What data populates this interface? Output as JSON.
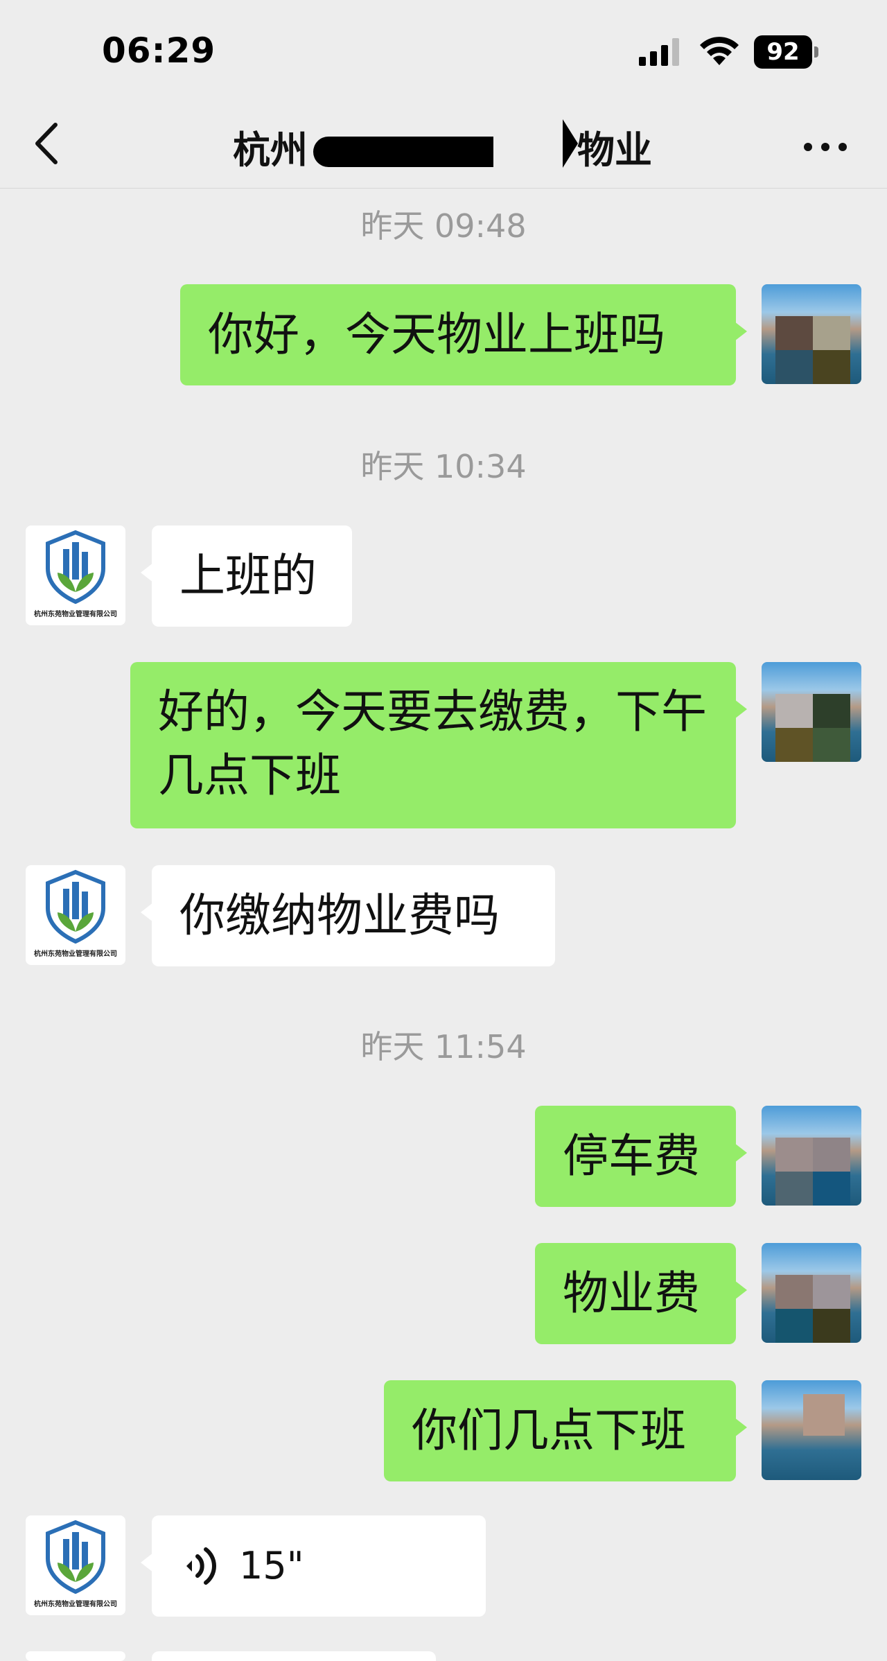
{
  "status_bar": {
    "time": "06:29",
    "battery": "92",
    "icons": [
      "signal-icon",
      "wifi-icon",
      "battery-icon"
    ]
  },
  "nav": {
    "title_visible_start": "杭州",
    "title_visible_end": "物业",
    "icons": [
      "chevron-left-icon",
      "more-icon"
    ]
  },
  "timestamps": [
    "昨天 09:48",
    "昨天 10:34",
    "昨天 11:54"
  ],
  "merchant": {
    "avatar_caption": "杭州东苑物业管理有限公司",
    "logo_icon": "building-leaf-logo-icon",
    "colors": {
      "blue": "#2b6fb6",
      "green": "#5aa63a"
    }
  },
  "messages": [
    {
      "direction": "out",
      "text": "你好，今天物业上班吗"
    },
    {
      "direction": "in",
      "text": "上班的"
    },
    {
      "direction": "out",
      "text": "好的，今天要去缴费，下午几点下班"
    },
    {
      "direction": "in",
      "text": "你缴纳物业费吗"
    },
    {
      "direction": "out",
      "text": "停车费"
    },
    {
      "direction": "out",
      "text": "物业费"
    },
    {
      "direction": "out",
      "text": "你们几点下班"
    },
    {
      "direction": "in",
      "type": "voice",
      "duration": "15\"",
      "icon": "voice-wave-icon"
    }
  ],
  "colors": {
    "background": "#ededed",
    "outgoing_bubble": "#95ec69",
    "incoming_bubble": "#ffffff",
    "timestamp_text": "#9a9a9a"
  }
}
